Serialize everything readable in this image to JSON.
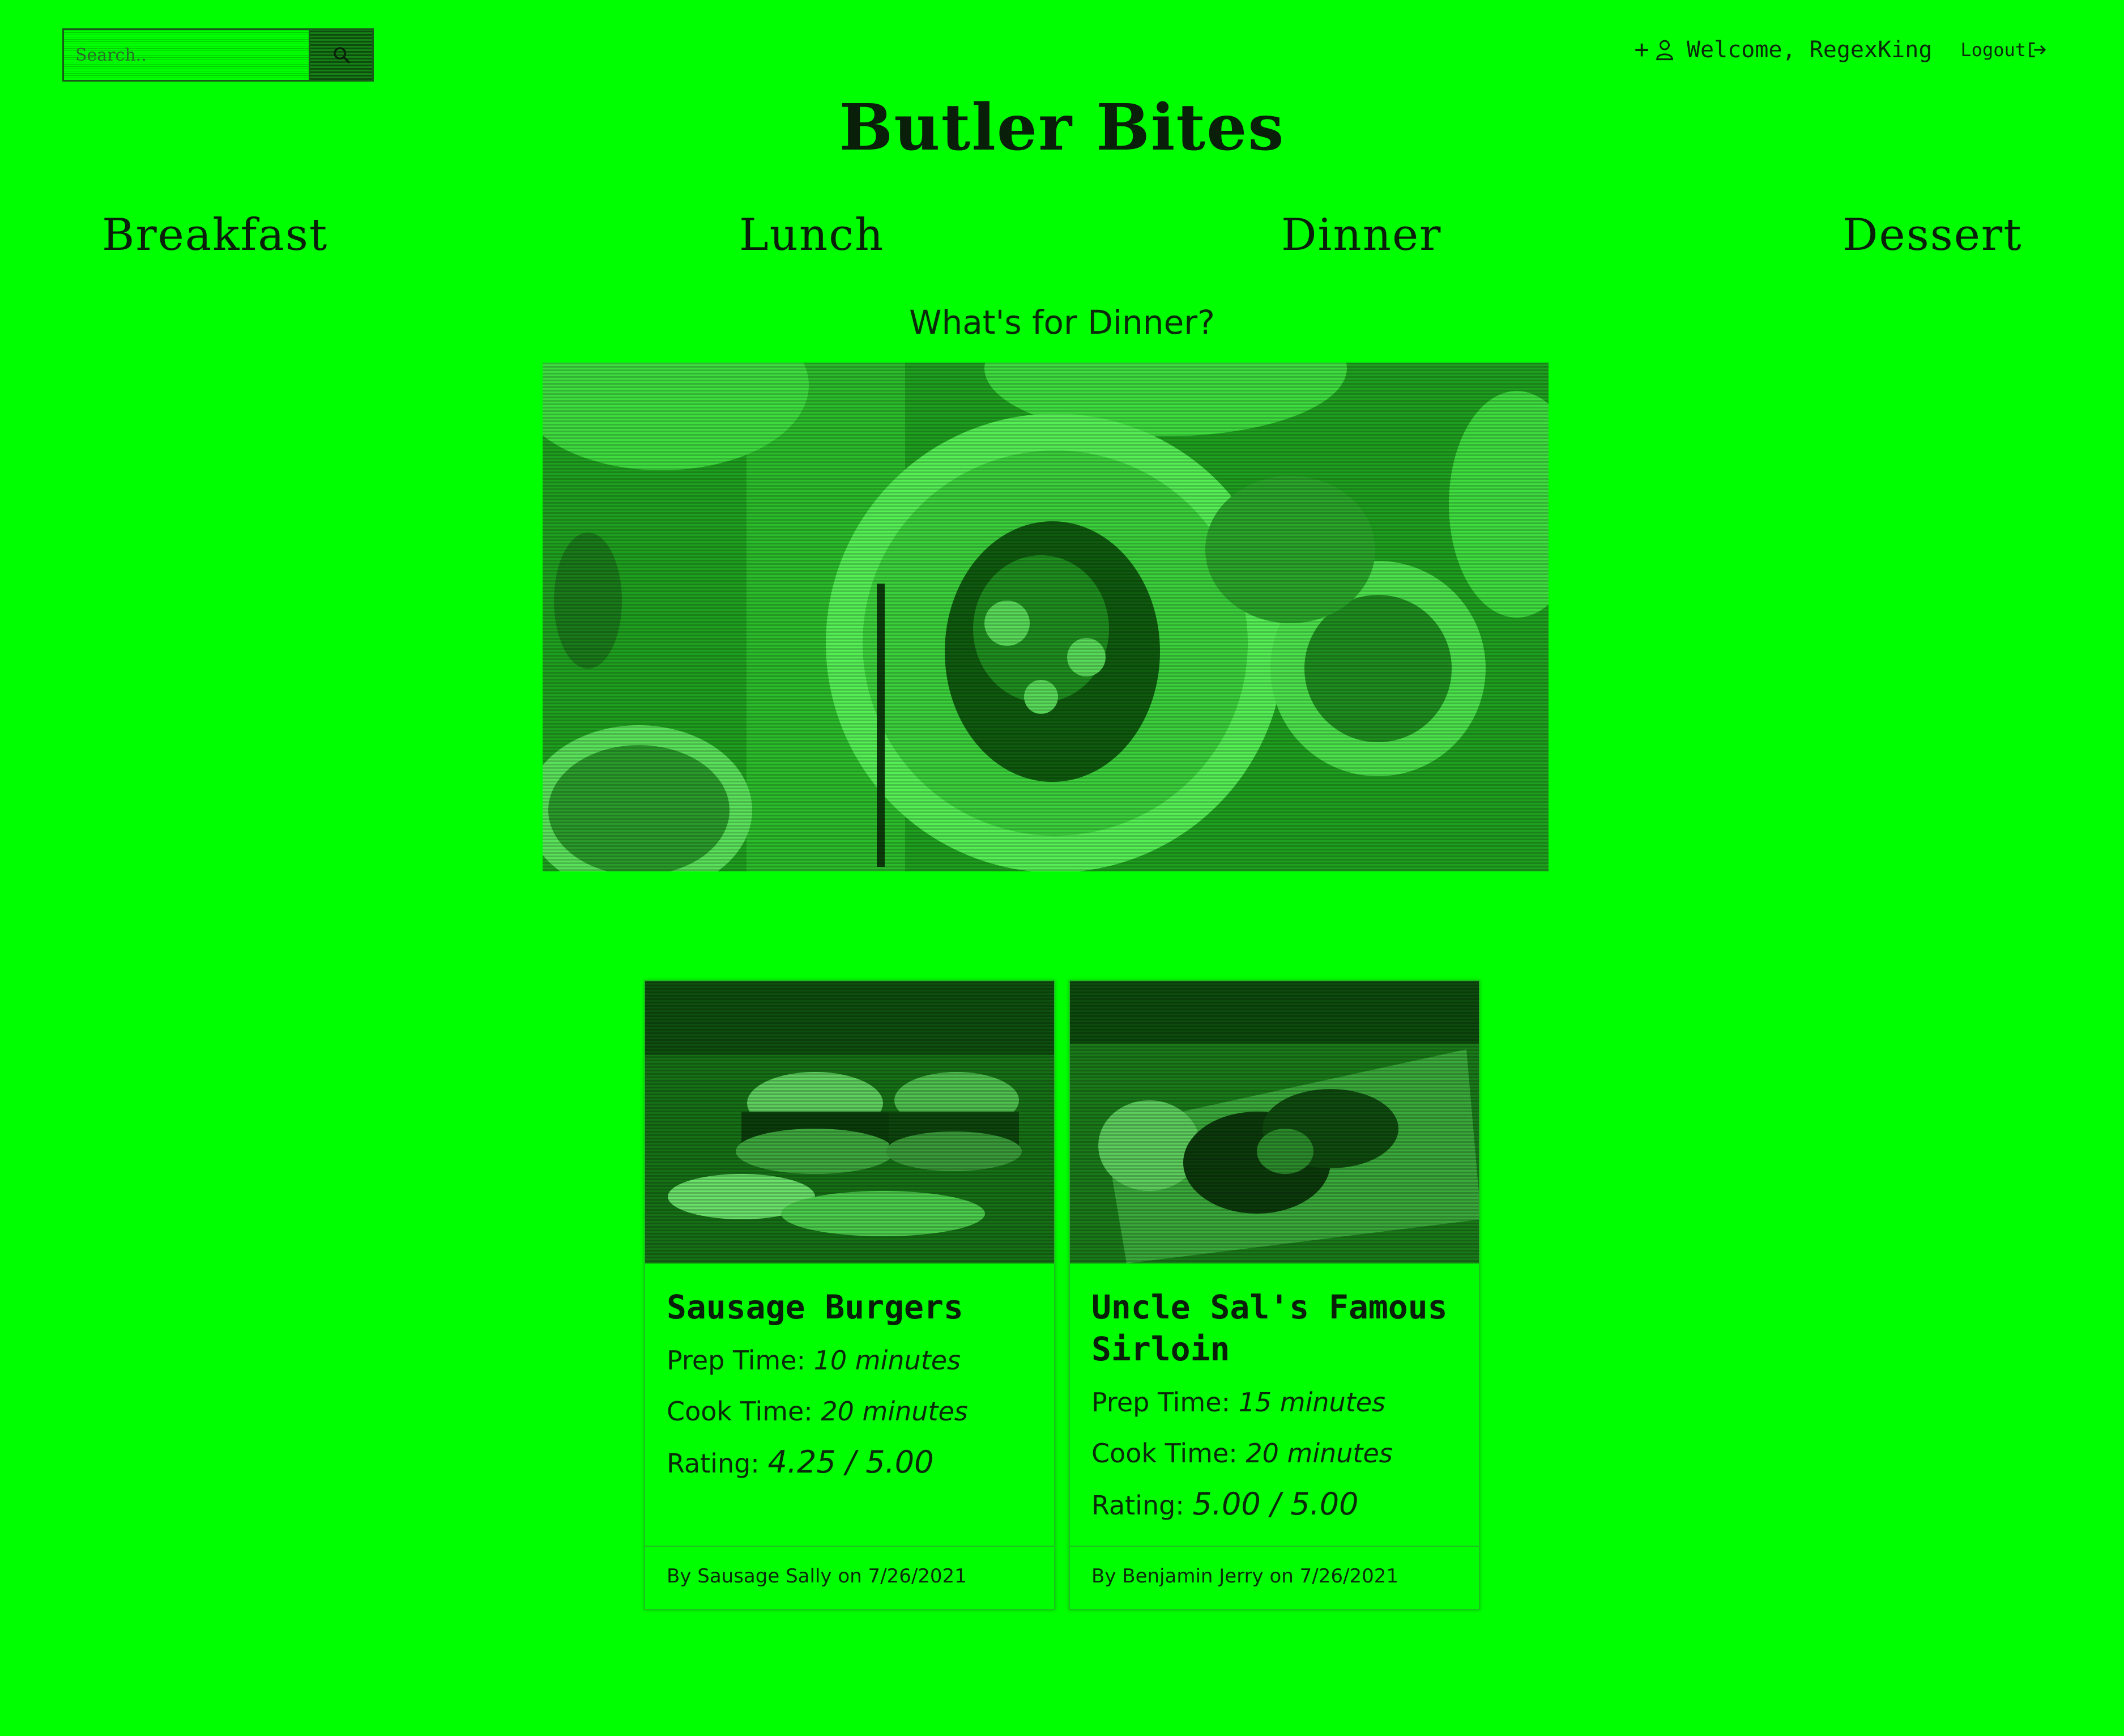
{
  "search": {
    "placeholder": "Search.."
  },
  "user": {
    "plus": "+",
    "welcome": "Welcome, RegexKing",
    "logout": "Logout"
  },
  "site": {
    "title": "Butler Bites"
  },
  "nav": [
    {
      "label": "Breakfast"
    },
    {
      "label": "Lunch"
    },
    {
      "label": "Dinner"
    },
    {
      "label": "Dessert"
    }
  ],
  "section": {
    "heading": "What's for Dinner?"
  },
  "recipes": [
    {
      "title": "Sausage Burgers",
      "prep_label": "Prep Time: ",
      "prep_value": "10 minutes",
      "cook_label": "Cook Time: ",
      "cook_value": "20 minutes",
      "rating_label": "Rating: ",
      "rating_value": "4.25 / 5.00",
      "byline": "By Sausage Sally on 7/26/2021"
    },
    {
      "title": "Uncle Sal's Famous Sirloin",
      "prep_label": "Prep Time: ",
      "prep_value": "15 minutes",
      "cook_label": "Cook Time: ",
      "cook_value": "20 minutes",
      "rating_label": "Rating: ",
      "rating_value": "5.00 / 5.00",
      "byline": "By Benjamin Jerry on 7/26/2021"
    }
  ],
  "icons": {
    "search": "search-icon",
    "user": "user-icon",
    "logout": "logout-arrow-icon"
  },
  "colors": {
    "background": "#00ff00",
    "text": "#0a1f0a"
  }
}
